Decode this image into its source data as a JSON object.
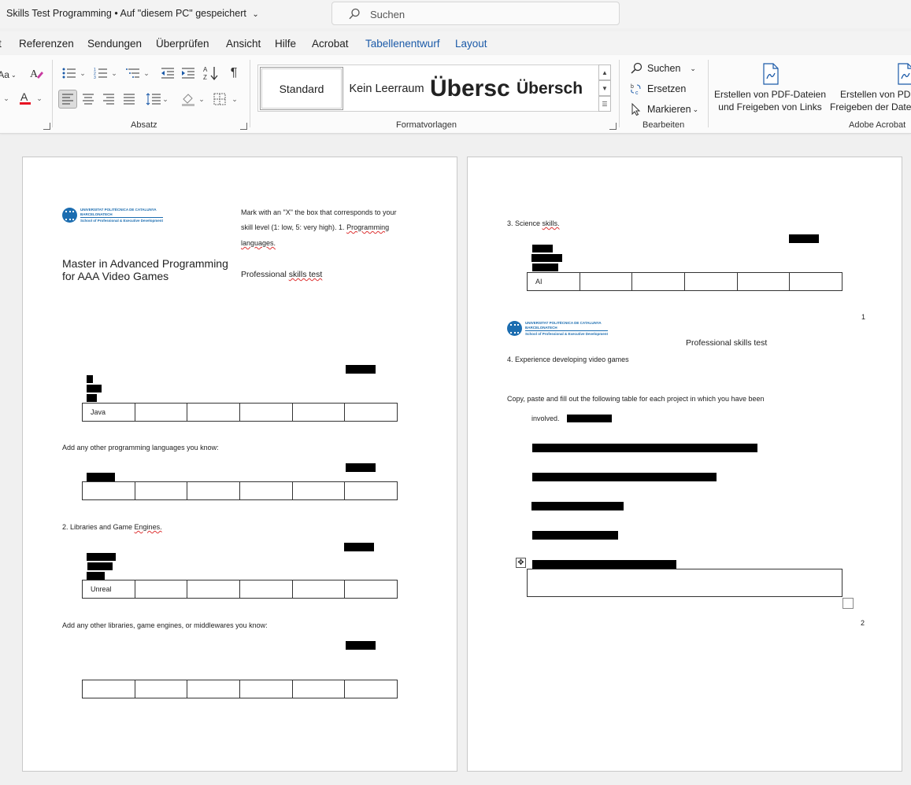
{
  "window": {
    "doc_title": "Skills Test Programming",
    "save_state": "Auf \"diesem PC\" gespeichert",
    "search_placeholder": "Suchen"
  },
  "tabs": [
    {
      "label": "t"
    },
    {
      "label": "Referenzen"
    },
    {
      "label": "Sendungen"
    },
    {
      "label": "Überprüfen"
    },
    {
      "label": "Ansicht"
    },
    {
      "label": "Hilfe"
    },
    {
      "label": "Acrobat"
    },
    {
      "label": "Tabellenentwurf",
      "contextual": true
    },
    {
      "label": "Layout",
      "contextual": true
    }
  ],
  "ribbon": {
    "font_partial": "Aa",
    "groups": {
      "absatz": "Absatz",
      "formatvorlagen": "Formatvorlagen",
      "bearbeiten": "Bearbeiten",
      "adobe": "Adobe Acrobat"
    },
    "styles": [
      "Standard",
      "Kein Leerraum",
      "Übersc",
      "Übersch"
    ],
    "editing": {
      "find": "Suchen",
      "replace": "Ersetzen",
      "select": "Markieren"
    },
    "acrobat": {
      "create_share_line1": "Erstellen von PDF-Dateien",
      "create_share_line2": "und Freigeben von Links",
      "create_share2_line1": "Erstellen von PDF",
      "create_share2_line2": "Freigeben der Datei"
    },
    "colors": {
      "font_color_bar": "#e81123",
      "accent": "#1b5aa8"
    }
  },
  "page1": {
    "logo_line1": "UNIVERSITAT POLITÈCNICA DE CATALUNYA",
    "logo_line2": "BARCELONATECH",
    "logo_line3": "School of Professional & Executive Development",
    "instruction_line1": "Mark with an \"X\" the box that corresponds to your",
    "instruction_line2a": "skill level (1: low, 5: very high).  1. ",
    "instruction_line2b": "Programming",
    "instruction_line3": "languages.",
    "master_line1": "Master in Advanced Programming",
    "master_line2": "for AAA Video Games",
    "test_label_a": "Professional ",
    "test_label_b": "skills test",
    "table1_first": "Java",
    "add_languages": "Add any other programming languages you know:",
    "section2a": "2. Libraries and Game ",
    "section2b": "Engines.",
    "table3_first": "Unreal",
    "add_libraries": "Add any other libraries, game engines, or middlewares you know:"
  },
  "page2": {
    "section3a": "3. Science ",
    "section3b": "skills.",
    "table_first": "AI",
    "page_number_1": "1",
    "logo_line1": "UNIVERSITAT POLITÈCNICA DE CATALUNYA",
    "logo_line2": "BARCELONATECH",
    "logo_line3": "School of Professional & Executive Development",
    "test_label": "Professional skills test",
    "section4": "4. Experience developing video games",
    "copy_instruction": "Copy, paste and fill out the following table for each project in which you have been",
    "involved": "involved.",
    "page_number_2": "2"
  }
}
